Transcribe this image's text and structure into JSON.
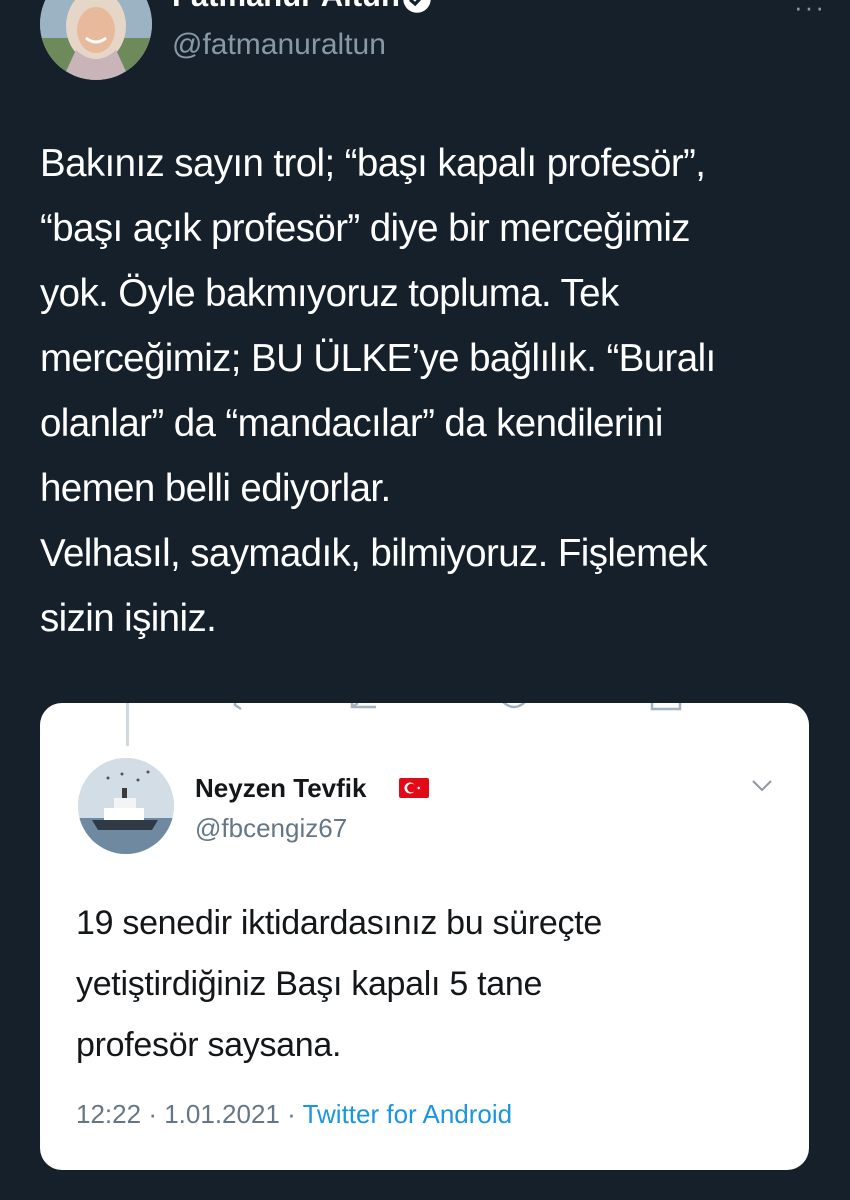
{
  "tweet": {
    "display_name": "Fatmanur Altun",
    "handle": "@fatmanuraltun",
    "more_label": "···",
    "text": "Bakınız sayın trol; “başı kapalı profesör”,\n“başı açık profesör” diye bir merceğimiz\nyok. Öyle bakmıyoruz topluma. Tek\nmerceğimiz; BU ÜLKE’ye bağlılık. “Buralı\nolanlar” da “mandacılar” da kendilerini\nhemen belli ediyorlar.\nVelhasıl, saymadık, bilmiyoruz. Fişlemek\nsizin işiniz."
  },
  "quoted": {
    "display_name": "Neyzen Tevfik",
    "handle": "@fbcengiz67",
    "text": "19 senedir iktidardasınız bu süreçte\nyetiştirdiğiniz Başı kapalı 5 tane\nprofesör saysana.",
    "time": "12:22",
    "date": "1.01.2021",
    "separator": "·",
    "source": "Twitter for Android",
    "flag_icon": "turkey-flag-icon"
  },
  "colors": {
    "background": "#15202b",
    "card": "#ffffff",
    "link": "#1b95e0",
    "verified": "#ffffff"
  }
}
